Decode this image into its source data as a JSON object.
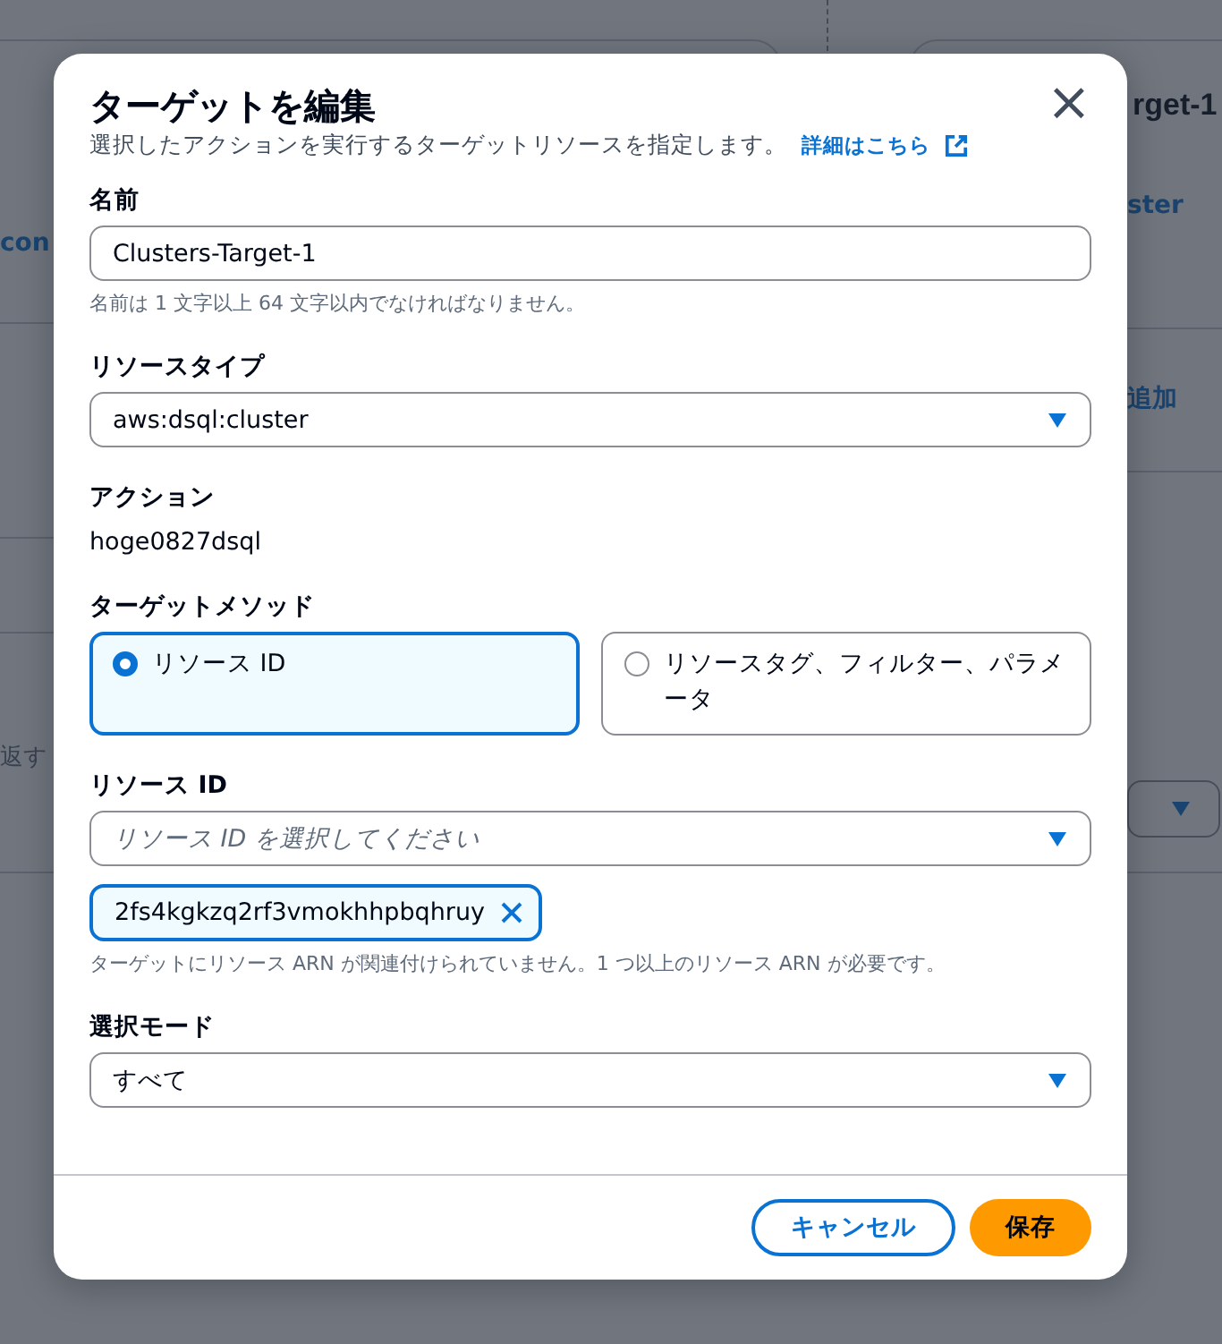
{
  "background": {
    "texts": [
      {
        "kind": "heading",
        "text": "rget-1"
      },
      {
        "kind": "link",
        "text": "con"
      },
      {
        "kind": "link",
        "text": "ster"
      },
      {
        "kind": "link",
        "text": "追加"
      },
      {
        "kind": "hint",
        "text": "返す"
      }
    ]
  },
  "modal": {
    "title": "ターゲットを編集",
    "description": "選択したアクションを実行するターゲットリソースを指定します。",
    "learn_more": "詳細はこちら",
    "close": "×",
    "name": {
      "label": "名前",
      "value": "Clusters-Target-1",
      "hint": "名前は 1 文字以上 64 文字以内でなければなりません。"
    },
    "resource_type": {
      "label": "リソースタイプ",
      "value": "aws:dsql:cluster"
    },
    "action": {
      "label": "アクション",
      "value": "hoge0827dsql"
    },
    "target_method": {
      "label": "ターゲットメソッド",
      "options": [
        {
          "label": "リソース ID",
          "selected": true
        },
        {
          "label": "リソースタグ、フィルター、パラメータ",
          "selected": false
        }
      ]
    },
    "resource_id": {
      "label": "リソース ID",
      "placeholder": "リソース ID を選択してください",
      "tokens": [
        "2fs4kgkzq2rf3vmokhhpbqhruy"
      ],
      "hint": "ターゲットにリソース ARN が関連付けられていません。1 つ以上のリソース ARN が必要です。"
    },
    "selection_mode": {
      "label": "選択モード",
      "value": "すべて"
    },
    "buttons": [
      {
        "kind": "secondary",
        "label": "キャンセル"
      },
      {
        "kind": "primary",
        "label": "保存"
      }
    ]
  }
}
